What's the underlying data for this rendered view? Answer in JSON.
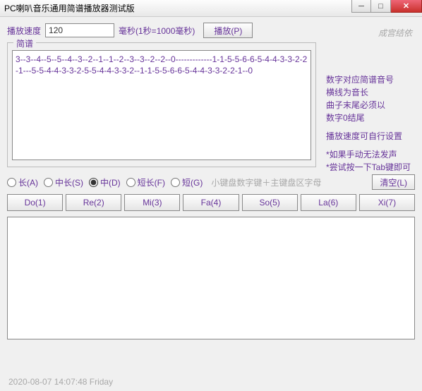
{
  "window": {
    "title": "PC喇叭音乐通用简谱播放器测试版",
    "author": "成宫结依"
  },
  "speed": {
    "label": "播放速度",
    "value": "120",
    "unit": "毫秒(1秒=1000毫秒)",
    "play_label": "播放(P)"
  },
  "notation": {
    "legend": "简谱",
    "content": "3--3--4--5--5--4--3--2--1--1--2--3--3--2--2--0-------------1-1-5-5-6-6-5-4-4-3-3-2-2-1---5-5-4-4-3-3-2-5-5-4-4-3-3-2--1-1-5-5-6-6-5-4-4-3-3-2-2-1--0"
  },
  "help": {
    "l1": "数字对应简谱音号",
    "l2": "横线为音长",
    "l3": "曲子末尾必须以",
    "l4": "数字0结尾",
    "l5": "播放速度可自行设置",
    "l6": "*如果手动无法发声",
    "l7": "*尝试按一下Tab键即可"
  },
  "length_options": {
    "a": "长(A)",
    "s": "中长(S)",
    "d": "中(D)",
    "f": "短长(F)",
    "g": "短(G)",
    "selected": "d",
    "hint": "小键盘数字键＋主键盘区字母",
    "clear": "清空(L)"
  },
  "notes": {
    "do": "Do(1)",
    "re": "Re(2)",
    "mi": "Mi(3)",
    "fa": "Fa(4)",
    "so": "So(5)",
    "la": "La(6)",
    "xi": "Xi(7)"
  },
  "output": "",
  "status": "2020-08-07 14:07:48  Friday"
}
